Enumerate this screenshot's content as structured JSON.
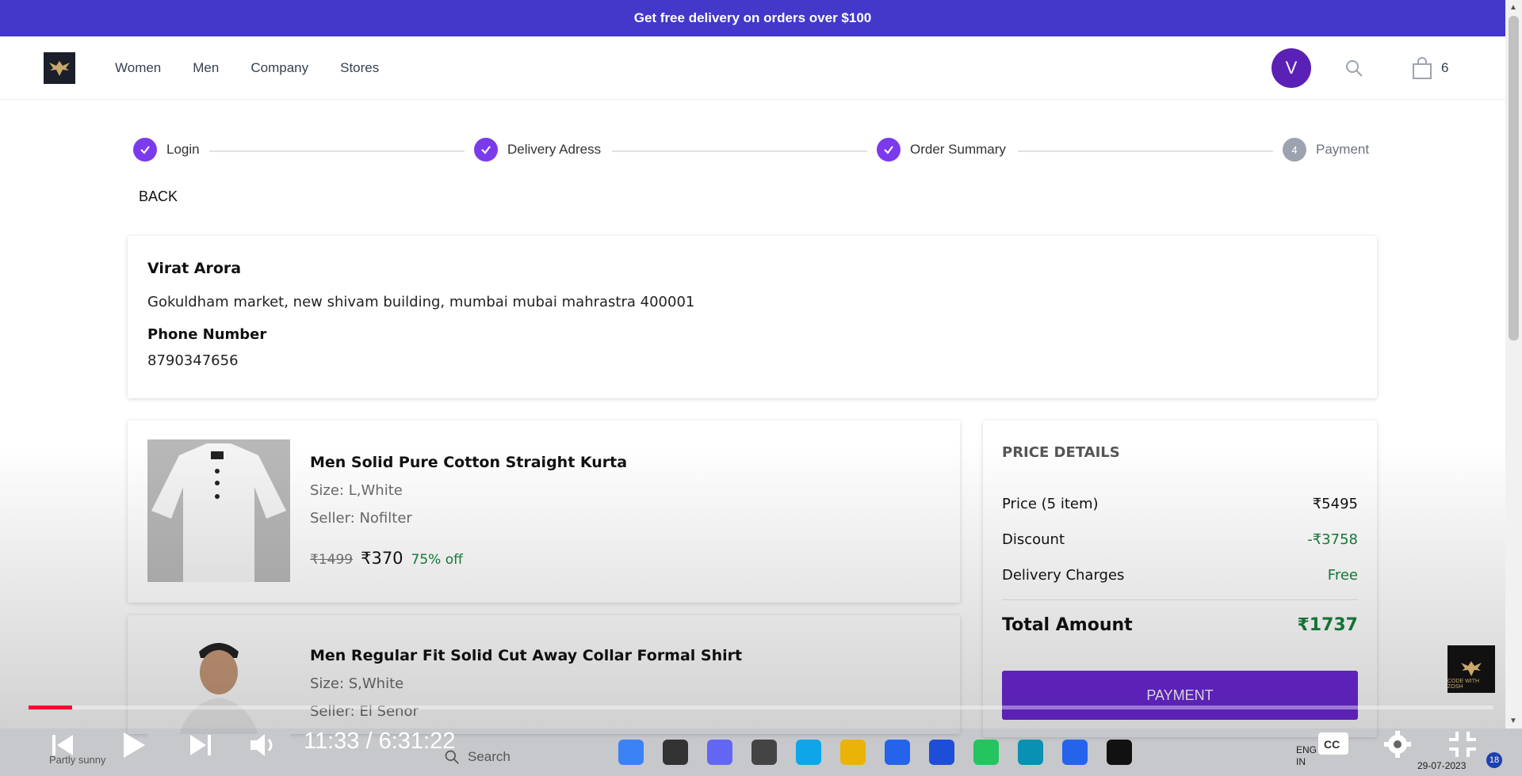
{
  "promo": {
    "text": "Get free delivery on orders over $100"
  },
  "nav": {
    "links": [
      "Women",
      "Men",
      "Company",
      "Stores"
    ],
    "avatar_letter": "V",
    "cart_count": "6"
  },
  "stepper": {
    "steps": [
      {
        "label": "Login",
        "state": "done"
      },
      {
        "label": "Delivery Adress",
        "state": "done"
      },
      {
        "label": "Order Summary",
        "state": "done"
      },
      {
        "label": "Payment",
        "state": "pending",
        "number": "4"
      }
    ]
  },
  "back_label": "BACK",
  "address": {
    "name": "Virat Arora",
    "line": "Gokuldham market, new shivam building, mumbai mubai mahrastra 400001",
    "phone_label": "Phone Number",
    "phone": "8790347656"
  },
  "items": [
    {
      "title": "Men Solid Pure Cotton Straight Kurta",
      "size": "Size: L,White",
      "seller": "Seller: Nofilter",
      "old_price": "₹1499",
      "price": "₹370",
      "discount": "75% off"
    },
    {
      "title": "Men Regular Fit Solid Cut Away Collar Formal Shirt",
      "size": "Size: S,White",
      "seller": "Seller: El Senor"
    }
  ],
  "price_details": {
    "title": "PRICE DETAILS",
    "price_label": "Price (5 item)",
    "price_value": "₹5495",
    "discount_label": "Discount",
    "discount_value": "-₹3758",
    "delivery_label": "Delivery Charges",
    "delivery_value": "Free",
    "total_label": "Total Amount",
    "total_value": "₹1737",
    "button": "PAYMENT"
  },
  "player": {
    "time": "11:33 / 6:31:22",
    "progress": 0.0295
  },
  "watermark": {
    "text": "CODE WITH ZOSH"
  },
  "taskbar": {
    "weather": "Partly sunny",
    "search_placeholder": "Search",
    "lang_line1": "ENG",
    "lang_line2": "IN",
    "date": "29-07-2023",
    "notifications": "18"
  },
  "colors": {
    "brand": "#4338ca",
    "accent": "#7c3aed",
    "green": "#16803c"
  }
}
